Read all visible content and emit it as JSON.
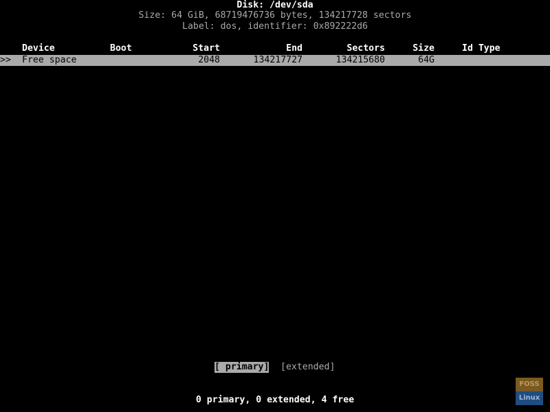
{
  "header": {
    "disk_title": "Disk: /dev/sda",
    "size_line": "Size: 64 GiB, 68719476736 bytes, 134217728 sectors",
    "label_line": "Label: dos, identifier: 0x892222d6"
  },
  "table": {
    "columns": {
      "device": "Device",
      "boot": "Boot",
      "start": "Start",
      "end": "End",
      "sectors": "Sectors",
      "size": "Size",
      "idtype": "Id Type"
    },
    "rows": [
      {
        "marker": ">>",
        "device": "Free space",
        "boot": "",
        "start": "2048",
        "end": "134217727",
        "sectors": "134215680",
        "size": "64G",
        "idtype": ""
      }
    ]
  },
  "menu": {
    "primary": "[ primary]",
    "extended": "[extended]"
  },
  "status": "0 primary, 0 extended, 4 free",
  "watermark": {
    "top": "FOSS",
    "bottom": "Linux"
  }
}
